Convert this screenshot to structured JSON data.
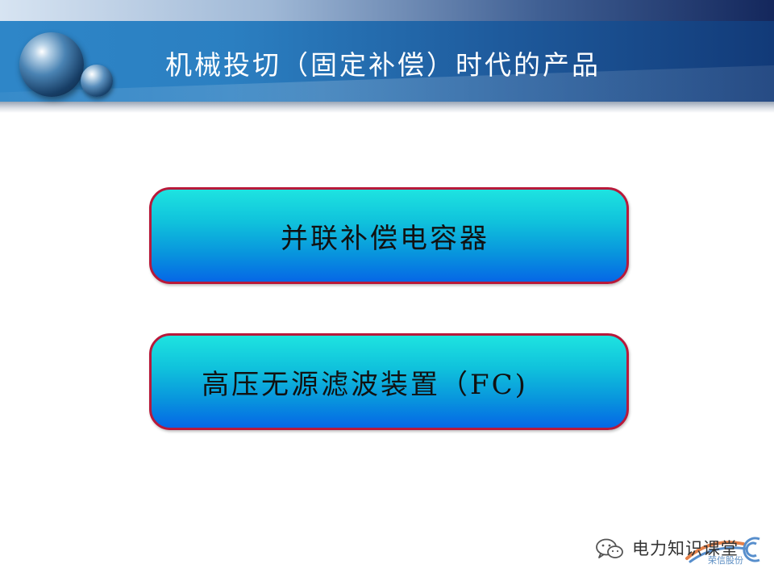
{
  "slide": {
    "title": "机械投切（固定补偿）时代的产品",
    "items": [
      {
        "label": "并联补偿电容器"
      },
      {
        "label": "高压无源滤波装置（FC)"
      }
    ]
  },
  "watermark": {
    "icon": "wechat-icon",
    "text": "电力知识课堂",
    "logo_subtext": "荣信股份"
  },
  "colors": {
    "header_blue": "#2b7fc1",
    "box_border": "#b8193a",
    "box_gradient_top": "#1ee3e0",
    "box_gradient_bottom": "#0567e6"
  }
}
